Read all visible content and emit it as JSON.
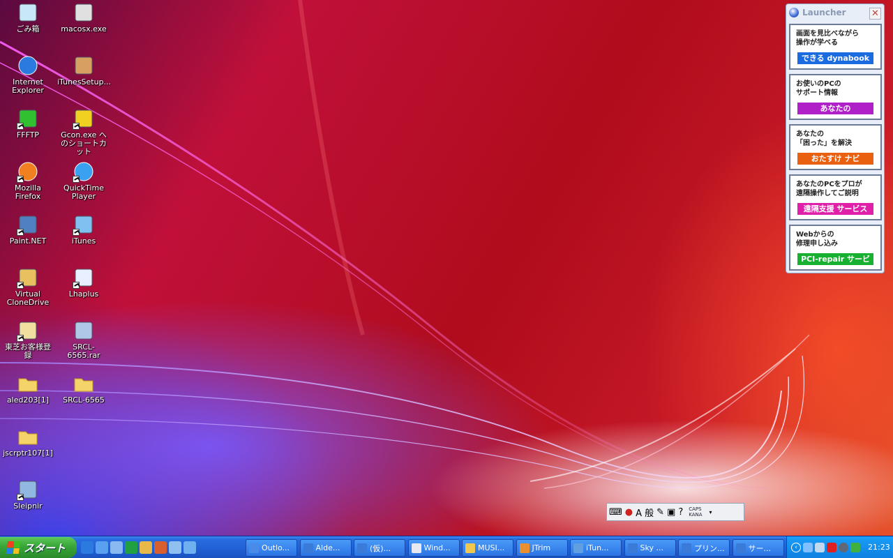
{
  "desktop": {
    "icons": [
      {
        "label": "ごみ箱",
        "icon": "recycle-bin-icon"
      },
      {
        "label": "macosx.exe",
        "icon": "exe-icon"
      },
      {
        "label": "Internet Explorer",
        "icon": "internet-explorer-icon"
      },
      {
        "label": "iTunesSetup...",
        "icon": "installer-icon"
      },
      {
        "label": "FFFTP",
        "icon": "ftp-icon"
      },
      {
        "label": "Gcon.exe へのショートカット",
        "icon": "gcon-icon"
      },
      {
        "label": "Mozilla Firefox",
        "icon": "firefox-icon"
      },
      {
        "label": "QuickTime Player",
        "icon": "quicktime-icon"
      },
      {
        "label": "Paint.NET",
        "icon": "paintnet-icon"
      },
      {
        "label": "iTunes",
        "icon": "itunes-icon"
      },
      {
        "label": "Virtual CloneDrive",
        "icon": "clonedrive-icon"
      },
      {
        "label": "Lhaplus",
        "icon": "lhaplus-icon"
      },
      {
        "label": "東芝お客様登録",
        "icon": "registration-icon"
      },
      {
        "label": "SRCL-6565.rar",
        "icon": "archive-icon"
      },
      {
        "label": "aled203[1]",
        "icon": "folder-icon"
      },
      {
        "label": "SRCL-6565",
        "icon": "folder-icon"
      },
      {
        "label": "jscrptr107[1]",
        "icon": "folder-icon"
      },
      {
        "label": "Sleipnir",
        "icon": "sleipnir-icon"
      }
    ]
  },
  "launcher": {
    "title": "Launcher",
    "close": "✕",
    "buttons": [
      {
        "text1": "画面を見比べながら",
        "text2": "操作が学べる",
        "band": "できる dynabook",
        "color": "#1a6ae0"
      },
      {
        "text1": "お使いのPCの",
        "text2": "サポート情報",
        "band": "あなたの dynabook.com",
        "color": "#b020c8"
      },
      {
        "text1": "あなたの",
        "text2": "「困った」を解決",
        "band": "おたすけ ナビ",
        "color": "#e86010"
      },
      {
        "text1": "あなたのPCをプロが",
        "text2": "遠隔操作してご説明",
        "band": "遠隔支援 サービス",
        "color": "#e020a8"
      },
      {
        "text1": "Webからの",
        "text2": "修理申し込み",
        "band": "PCI-repair サービス",
        "color": "#18b030"
      }
    ]
  },
  "langbar": {
    "mode": "A 般",
    "caps": "CAPS",
    "kana": "KANA"
  },
  "taskbar": {
    "start_label": "スタート",
    "buttons": [
      {
        "label": "Outlo...",
        "color": "#4a8ae8"
      },
      {
        "label": "Alde...",
        "color": "#3a7ad8"
      },
      {
        "label": "(仮)...",
        "color": "#3a7ad8"
      },
      {
        "label": "Wind...",
        "color": "#e8e8f0"
      },
      {
        "label": "MUSI...",
        "color": "#f0c850"
      },
      {
        "label": "JTrim",
        "color": "#e89030"
      },
      {
        "label": "iTun...",
        "color": "#60a0e0"
      },
      {
        "label": "Sky ...",
        "color": "#3a7ad8"
      },
      {
        "label": "プリン...",
        "color": "#3a7ad8"
      },
      {
        "label": "サー...",
        "color": "#3a7ad8"
      }
    ],
    "clock": "21:23"
  }
}
